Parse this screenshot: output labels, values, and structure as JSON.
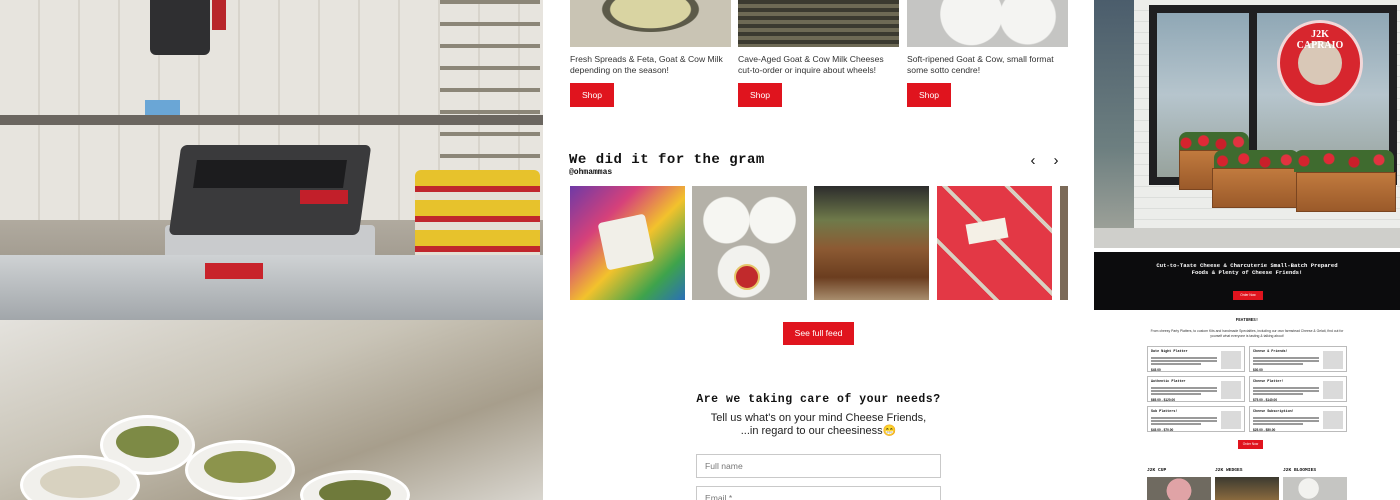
{
  "products": [
    {
      "description": "Fresh Spreads & Feta, Goat & Cow Milk depending on the season!",
      "button": "Shop"
    },
    {
      "description": "Cave-Aged Goat & Cow Milk Cheeses cut-to-order or inquire about wheels!",
      "button": "Shop"
    },
    {
      "description": "Soft-ripened Goat & Cow, small format some sotto cendre!",
      "button": "Shop"
    }
  ],
  "instagram": {
    "title": "We did it for the gram",
    "handle": "@ohmammas",
    "prev_icon": "chevron-left-icon",
    "next_icon": "chevron-right-icon",
    "prev_glyph": "‹",
    "next_glyph": "›",
    "feed_button": "See full feed"
  },
  "needs": {
    "title": "Are we taking care of your needs?",
    "line1": "Tell us what's on your mind Cheese Friends,",
    "line2": "...in regard to our cheesiness😁"
  },
  "form": {
    "fullname_placeholder": "Full name",
    "email_placeholder": "Email *"
  },
  "storefront": {
    "logo_text": "J2K CAPRAIO",
    "logo_tagline": "TASTE THE EXPERIENCE"
  },
  "site_preview": {
    "hero": "Cut-to-Taste Cheese & Charcuterie Small-Batch Prepared Foods & Plenty of Cheese Friends!",
    "hero_button": "Order Now",
    "features_title": "FEATURES!",
    "features_sub": "From cheesy Party Platters, to custom Kits and handmade Specialties, including our own farmstead Cheese & Gelati, find out for yourself what everyone is tasting & talking about!",
    "cards": [
      {
        "title": "Date Night Platter",
        "price": "$45.00"
      },
      {
        "title": "Cheese & Friends!",
        "price": "$30.00"
      },
      {
        "title": "Authentic Platter",
        "price": "$65.00 - $120.00"
      },
      {
        "title": "Cheese Platter!",
        "price": "$75.00 - $140.00"
      },
      {
        "title": "Sub Platters!",
        "price": "$45.00 - $70.00"
      },
      {
        "title": "Cheese Subscription!",
        "price": "$25.00 - $50.00"
      }
    ],
    "order_button": "Order Now",
    "mini_labels": [
      "J2K CUP",
      "J2K WEDGES",
      "J2K BLOOMIES"
    ]
  },
  "colors": {
    "accent_red": "#e0141e",
    "text_dark": "#111111"
  }
}
